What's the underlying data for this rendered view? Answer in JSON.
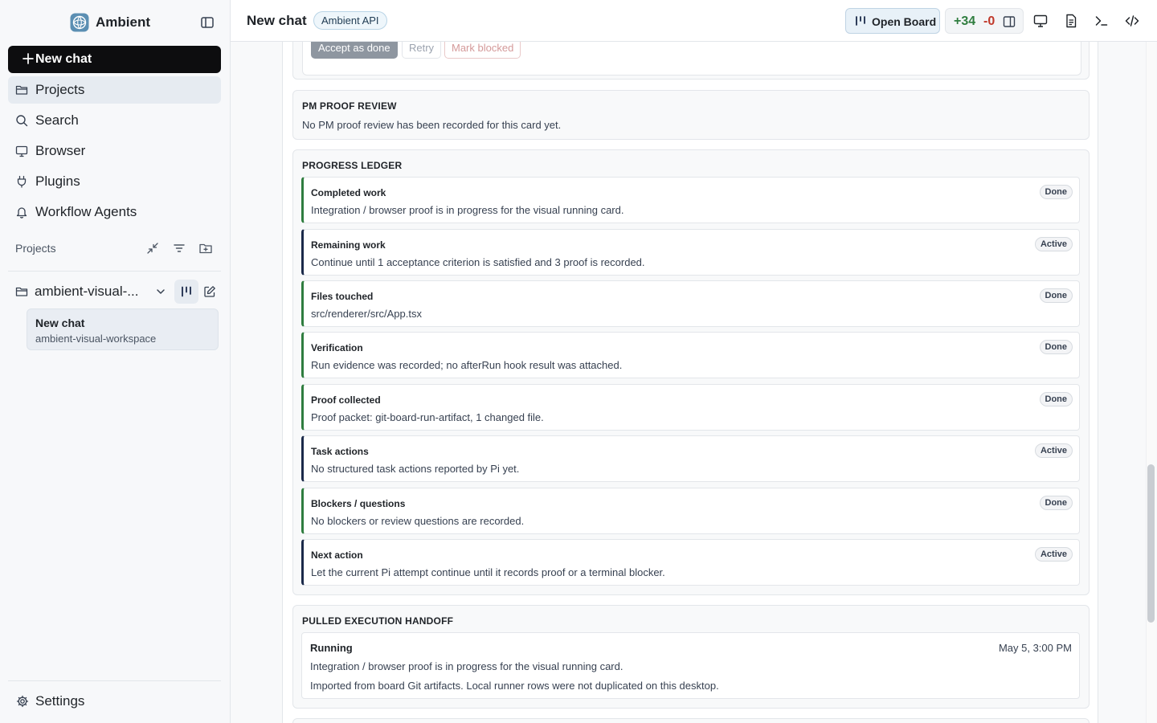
{
  "app": {
    "name": "Ambient"
  },
  "sidebar": {
    "new_chat_label": "New chat",
    "nav": [
      {
        "label": "Projects",
        "icon": "folder-icon",
        "active": true
      },
      {
        "label": "Search",
        "icon": "search-icon",
        "active": false
      },
      {
        "label": "Browser",
        "icon": "monitor-icon",
        "active": false
      },
      {
        "label": "Plugins",
        "icon": "plug-icon",
        "active": false
      },
      {
        "label": "Workflow Agents",
        "icon": "bell-icon",
        "active": false
      }
    ],
    "projects_header": "Projects",
    "project": {
      "name": "ambient-visual-...",
      "chat": {
        "title": "New chat",
        "subtitle": "ambient-visual-workspace"
      }
    },
    "settings_label": "Settings"
  },
  "topbar": {
    "title": "New chat",
    "badge": "Ambient API",
    "open_board_label": "Open Board",
    "diff_added": "+34",
    "diff_removed": "-0"
  },
  "actions": {
    "accept": "Accept as done",
    "retry": "Retry",
    "mark_blocked": "Mark blocked"
  },
  "pm_review": {
    "title": "PM PROOF REVIEW",
    "text": "No PM proof review has been recorded for this card yet."
  },
  "ledger": {
    "title": "PROGRESS LEDGER",
    "items": [
      {
        "title": "Completed work",
        "desc": "Integration / browser proof is in progress for the visual running card.",
        "status": "Done"
      },
      {
        "title": "Remaining work",
        "desc": "Continue until 1 acceptance criterion is satisfied and 3 proof is recorded.",
        "status": "Active"
      },
      {
        "title": "Files touched",
        "desc": "src/renderer/src/App.tsx",
        "status": "Done"
      },
      {
        "title": "Verification",
        "desc": "Run evidence was recorded; no afterRun hook result was attached.",
        "status": "Done"
      },
      {
        "title": "Proof collected",
        "desc": "Proof packet: git-board-run-artifact, 1 changed file.",
        "status": "Done"
      },
      {
        "title": "Task actions",
        "desc": "No structured task actions reported by Pi yet.",
        "status": "Active"
      },
      {
        "title": "Blockers / questions",
        "desc": "No blockers or review questions are recorded.",
        "status": "Done"
      },
      {
        "title": "Next action",
        "desc": "Let the current Pi attempt continue until it records proof or a terminal blocker.",
        "status": "Active"
      }
    ]
  },
  "handoff": {
    "title": "PULLED EXECUTION HANDOFF",
    "status": "Running",
    "date": "May 5, 3:00 PM",
    "line1": "Integration / browser proof is in progress for the visual running card.",
    "line2": "Imported from board Git artifacts. Local runner rows were not duplicated on this desktop."
  },
  "colors": {
    "accent_dark": "#0d0d0f",
    "done_border": "#2f7d3f",
    "active_border": "#1b2a4a",
    "diff_add": "#2f7d3f",
    "diff_remove": "#c0392b"
  }
}
